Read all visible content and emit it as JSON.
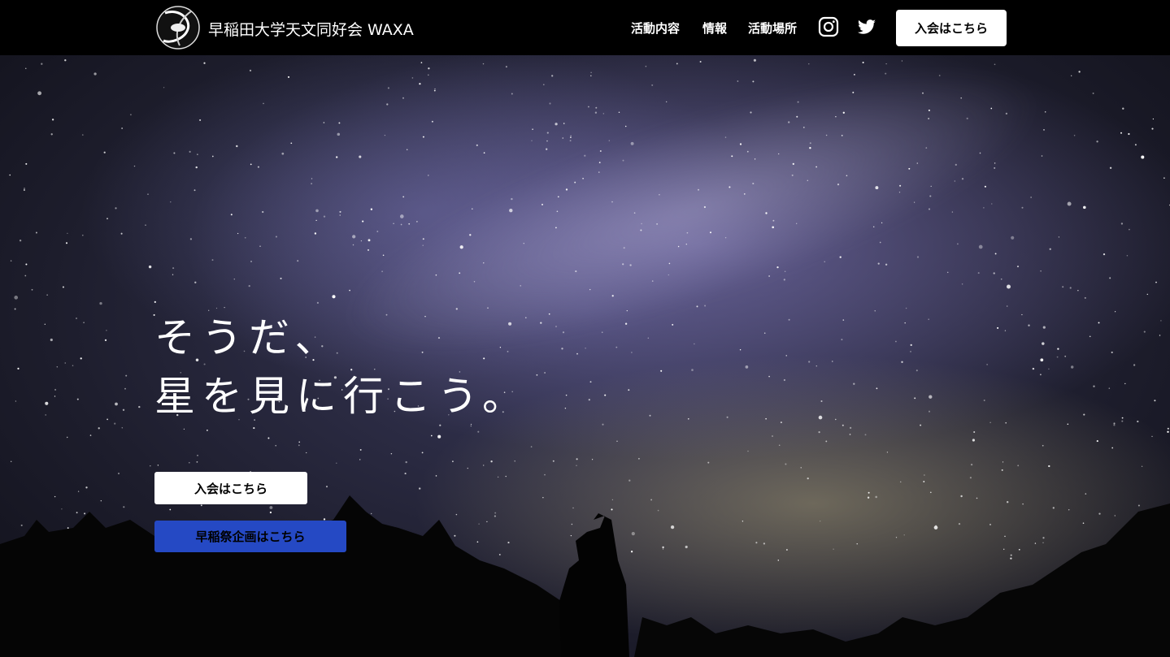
{
  "header": {
    "site_title": "早稲田大学天文同好会 WAXA",
    "nav": [
      {
        "label": "活動内容"
      },
      {
        "label": "情報"
      },
      {
        "label": "活動場所"
      }
    ],
    "social_icons": [
      "instagram-icon",
      "twitter-icon"
    ],
    "cta_label": "入会はこちら"
  },
  "hero": {
    "headline_line1": "そうだ、",
    "headline_line2": "星を見に行こう。",
    "join_button_label": "入会はこちら",
    "festival_button_label": "早稲祭企画はこちら"
  },
  "colors": {
    "header_bg": "#000000",
    "festival_button": "#2549c4",
    "button_white": "#ffffff"
  }
}
